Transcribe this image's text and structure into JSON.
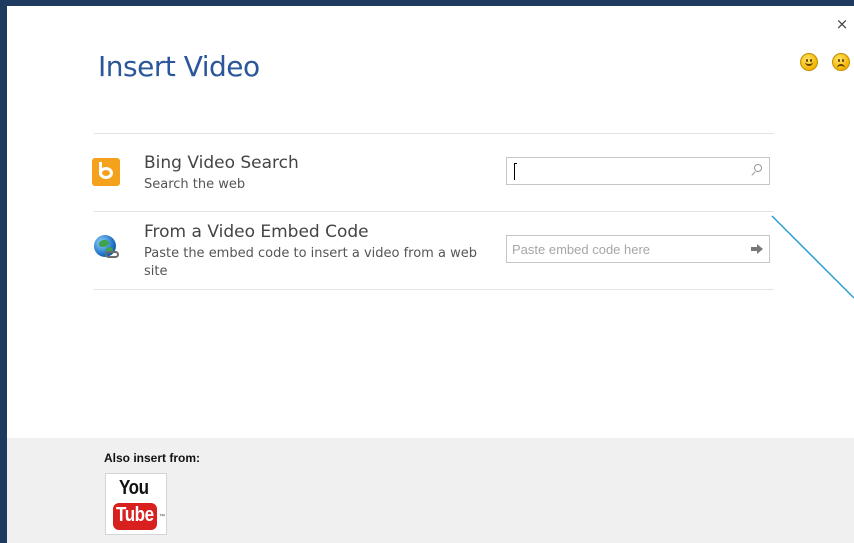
{
  "dialog": {
    "title": "Insert Video",
    "close_label": "×"
  },
  "options": [
    {
      "icon": "bing-icon",
      "title": "Bing Video Search",
      "description": "Search the web",
      "input_value": "",
      "input_placeholder": ""
    },
    {
      "icon": "globe-link-icon",
      "title": "From a Video Embed Code",
      "description": "Paste the embed code to insert a video from a web site",
      "input_value": "",
      "input_placeholder": "Paste embed code here"
    }
  ],
  "footer": {
    "also_label": "Also insert from:",
    "youtube": {
      "you": "You",
      "tube": "Tube",
      "tm": "™"
    }
  },
  "colors": {
    "title": "#2b579a",
    "bing": "#f4a21c",
    "youtube_red": "#d8201f",
    "footer_bg": "#f0f0f0",
    "window_frame": "#1f3a5f"
  }
}
